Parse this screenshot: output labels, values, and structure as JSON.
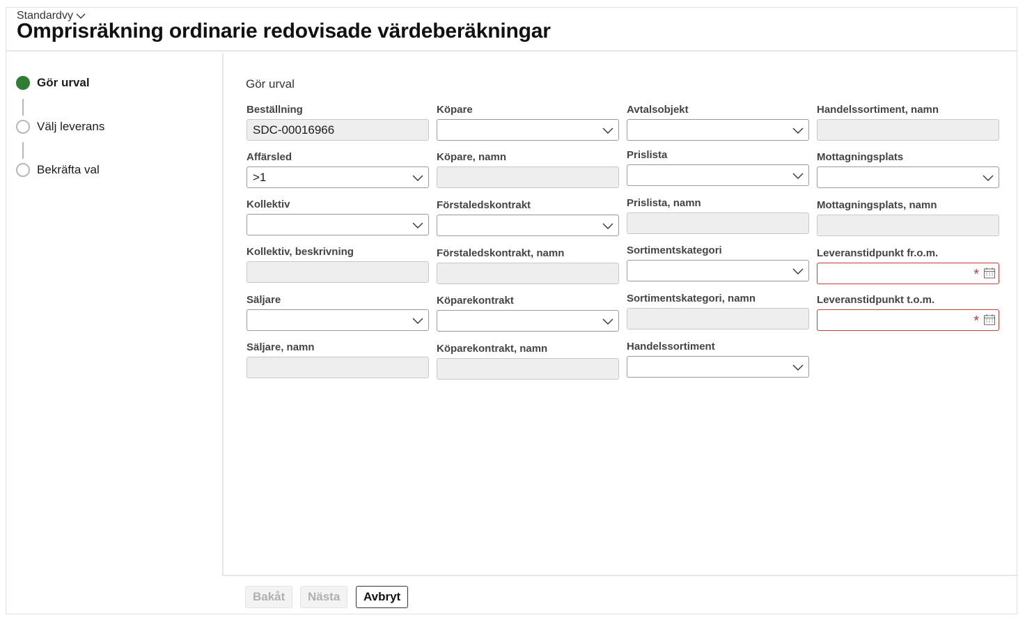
{
  "header": {
    "view_label": "Standardvy",
    "title": "Omprisräkning ordinarie redovisade värdeberäkningar"
  },
  "steps": [
    {
      "label": "Gör urval",
      "state": "active"
    },
    {
      "label": "Välj leverans",
      "state": "pending"
    },
    {
      "label": "Bekräfta val",
      "state": "pending"
    }
  ],
  "form": {
    "section_title": "Gör urval",
    "fields": {
      "bestallning": {
        "label": "Beställning",
        "value": "SDC-00016966"
      },
      "affarsled": {
        "label": "Affärsled",
        "value": ">1"
      },
      "kollektiv": {
        "label": "Kollektiv",
        "value": ""
      },
      "kollektiv_beskrivning": {
        "label": "Kollektiv, beskrivning",
        "value": ""
      },
      "saljare": {
        "label": "Säljare",
        "value": ""
      },
      "saljare_namn": {
        "label": "Säljare, namn",
        "value": ""
      },
      "kopare": {
        "label": "Köpare",
        "value": ""
      },
      "kopare_namn": {
        "label": "Köpare, namn",
        "value": ""
      },
      "forstaledskontrakt": {
        "label": "Förstaledskontrakt",
        "value": ""
      },
      "forstaledskontrakt_namn": {
        "label": "Förstaledskontrakt, namn",
        "value": ""
      },
      "koparekontrakt": {
        "label": "Köparekontrakt",
        "value": ""
      },
      "koparekontrakt_namn": {
        "label": "Köparekontrakt, namn",
        "value": ""
      },
      "avtalsobjekt": {
        "label": "Avtalsobjekt",
        "value": ""
      },
      "prislista": {
        "label": "Prislista",
        "value": ""
      },
      "prislista_namn": {
        "label": "Prislista, namn",
        "value": ""
      },
      "sortimentskategori": {
        "label": "Sortimentskategori",
        "value": ""
      },
      "sortimentskategori_namn": {
        "label": "Sortimentskategori, namn",
        "value": ""
      },
      "handelssortiment": {
        "label": "Handelssortiment",
        "value": ""
      },
      "handelssortiment_namn": {
        "label": "Handelssortiment, namn",
        "value": ""
      },
      "mottagningsplats": {
        "label": "Mottagningsplats",
        "value": ""
      },
      "mottagningsplats_namn": {
        "label": "Mottagningsplats, namn",
        "value": ""
      },
      "leveranstidpunkt_from": {
        "label": "Leveranstidpunkt fr.o.m.",
        "value": "",
        "required_mark": "*"
      },
      "leveranstidpunkt_tom": {
        "label": "Leveranstidpunkt t.o.m.",
        "value": "",
        "required_mark": "*"
      }
    }
  },
  "footer": {
    "back_label": "Bakåt",
    "next_label": "Nästa",
    "cancel_label": "Avbryt"
  },
  "colors": {
    "active_step": "#2e7d32",
    "required_border": "#c43b3b",
    "readonly_bg": "#eeeeee"
  },
  "icons": {
    "dropdown": "chevron-down-icon",
    "calendar": "calendar-icon"
  }
}
